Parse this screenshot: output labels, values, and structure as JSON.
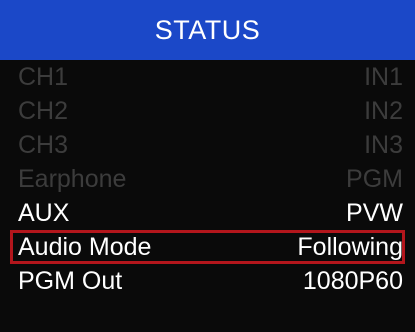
{
  "header": {
    "title": "STATUS"
  },
  "rows": [
    {
      "label": "CH1",
      "value": "IN1",
      "state": "dim"
    },
    {
      "label": "CH2",
      "value": "IN2",
      "state": "dim"
    },
    {
      "label": "CH3",
      "value": "IN3",
      "state": "dim"
    },
    {
      "label": "Earphone",
      "value": "PGM",
      "state": "dim"
    },
    {
      "label": "AUX",
      "value": "PVW",
      "state": "active"
    },
    {
      "label": "Audio Mode",
      "value": "Following",
      "state": "selected"
    },
    {
      "label": "PGM Out",
      "value": "1080P60",
      "state": "active"
    }
  ],
  "colors": {
    "header_bg": "#1b48c8",
    "selection_border": "#b3161c",
    "dim_text": "#3c3c3c",
    "active_text": "#ffffff",
    "screen_bg": "#0a0a0a"
  }
}
